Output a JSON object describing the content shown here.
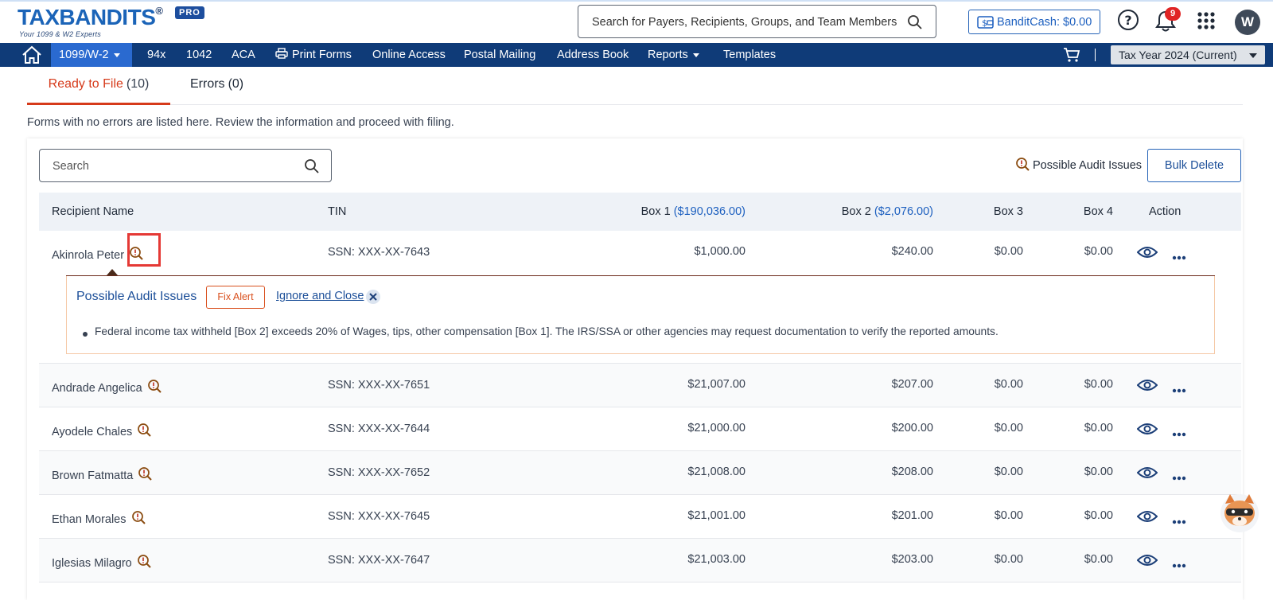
{
  "header": {
    "logo": {
      "text": "TAXBANDITS",
      "reg": "®",
      "tagline": "Your 1099 & W2 Experts",
      "badge": "PRO"
    },
    "search_placeholder": "Search for Payers, Recipients, Groups, and Team Members",
    "bandit_cash": "BanditCash: $0.00",
    "notifications_count": "9",
    "avatar_initial": "W"
  },
  "nav": {
    "items": [
      "1099/W-2",
      "94x",
      "1042",
      "ACA",
      "Print Forms",
      "Online Access",
      "Postal Mailing",
      "Address Book",
      "Reports",
      "Templates"
    ],
    "tax_year": "Tax Year 2024 (Current)"
  },
  "tabs": [
    {
      "label": "Ready to File",
      "count": "(10)"
    },
    {
      "label": "Errors",
      "count": "(0)"
    }
  ],
  "description": "Forms with no errors are listed here. Review the information and proceed with filing.",
  "toolbar": {
    "search_placeholder": "Search",
    "audit_legend": "Possible Audit Issues",
    "bulk_delete": "Bulk Delete"
  },
  "table": {
    "headers": {
      "recipient": "Recipient Name",
      "tin": "TIN",
      "box1": "Box 1",
      "box1_total": "($190,036.00)",
      "box2": "Box 2",
      "box2_total": "($2,076.00)",
      "box3": "Box 3",
      "box4": "Box 4",
      "action": "Action"
    },
    "rows": [
      {
        "name": "Akinrola Peter",
        "tin": "SSN: XXX-XX-7643",
        "box1": "$1,000.00",
        "box2": "$240.00",
        "box3": "$0.00",
        "box4": "$0.00"
      },
      {
        "name": "Andrade Angelica",
        "tin": "SSN: XXX-XX-7651",
        "box1": "$21,007.00",
        "box2": "$207.00",
        "box3": "$0.00",
        "box4": "$0.00"
      },
      {
        "name": "Ayodele Chales",
        "tin": "SSN: XXX-XX-7644",
        "box1": "$21,000.00",
        "box2": "$200.00",
        "box3": "$0.00",
        "box4": "$0.00"
      },
      {
        "name": "Brown Fatmatta",
        "tin": "SSN: XXX-XX-7652",
        "box1": "$21,008.00",
        "box2": "$208.00",
        "box3": "$0.00",
        "box4": "$0.00"
      },
      {
        "name": "Ethan Morales",
        "tin": "SSN: XXX-XX-7645",
        "box1": "$21,001.00",
        "box2": "$201.00",
        "box3": "$0.00",
        "box4": "$0.00"
      },
      {
        "name": "Iglesias Milagro",
        "tin": "SSN: XXX-XX-7647",
        "box1": "$21,003.00",
        "box2": "$203.00",
        "box3": "$0.00",
        "box4": "$0.00"
      }
    ]
  },
  "audit_panel": {
    "title": "Possible Audit Issues",
    "fix_alert": "Fix Alert",
    "ignore_close": "Ignore and Close",
    "message": "Federal income tax withheld [Box 2] exceeds 20% of Wages, tips, other compensation [Box 1]. The IRS/SSA or other agencies may request documentation to verify the reported amounts."
  },
  "colors": {
    "nav_bg": "#0f3b78",
    "nav_active": "#2a6ad0",
    "accent_red": "#d63a1a",
    "link_blue": "#1c4f99",
    "audit_orange": "#d9501e"
  }
}
